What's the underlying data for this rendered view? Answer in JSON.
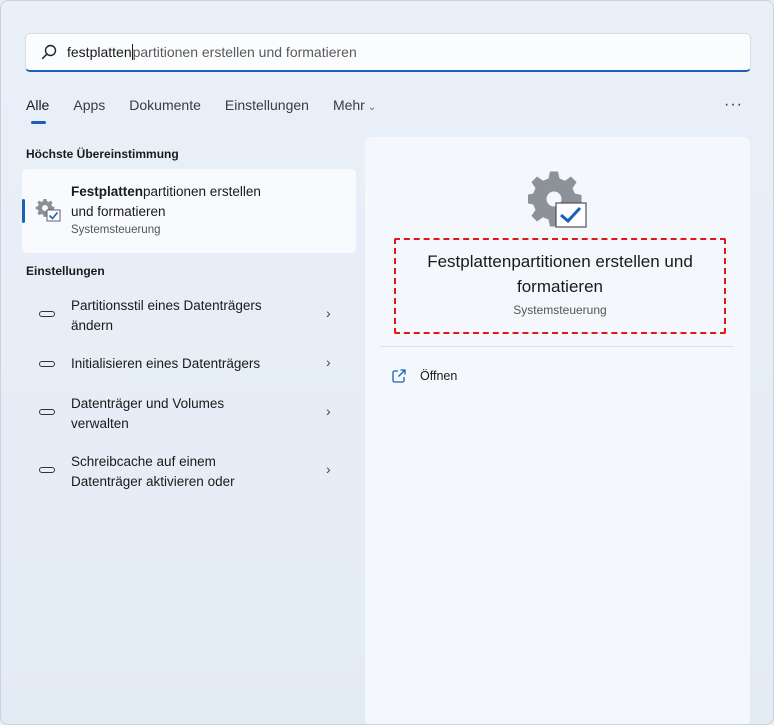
{
  "search": {
    "typed": "festplatten",
    "suggestion": "partitionen erstellen und formatieren"
  },
  "tabs": [
    {
      "label": "Alle",
      "active": true
    },
    {
      "label": "Apps"
    },
    {
      "label": "Dokumente"
    },
    {
      "label": "Einstellungen"
    },
    {
      "label": "Mehr"
    }
  ],
  "more_menu": "···",
  "best_match": {
    "section_label": "Höchste Übereinstimmung",
    "title_bold": "Festplatten",
    "title_rest_line1": "partitionen erstellen",
    "title_line2": "und formatieren",
    "subtitle": "Systemsteuerung",
    "icon": "gear-checkbox-icon"
  },
  "settings": {
    "section_label": "Einstellungen",
    "items": [
      {
        "line1": "Partitionsstil eines Datenträgers",
        "line2": "ändern"
      },
      {
        "line1": "Initialisieren eines Datenträgers",
        "line2": ""
      },
      {
        "line1": "Datenträger und Volumes",
        "line2": "verwalten"
      },
      {
        "line1": "Schreibcache auf einem",
        "line2": "Datenträger aktivieren oder"
      }
    ]
  },
  "preview": {
    "title_line1": "Festplattenpartitionen erstellen und",
    "title_line2": "formatieren",
    "subtitle": "Systemsteuerung",
    "open_label": "Öffnen"
  },
  "colors": {
    "accent": "#1c5fb5",
    "highlight": "#e01818"
  }
}
